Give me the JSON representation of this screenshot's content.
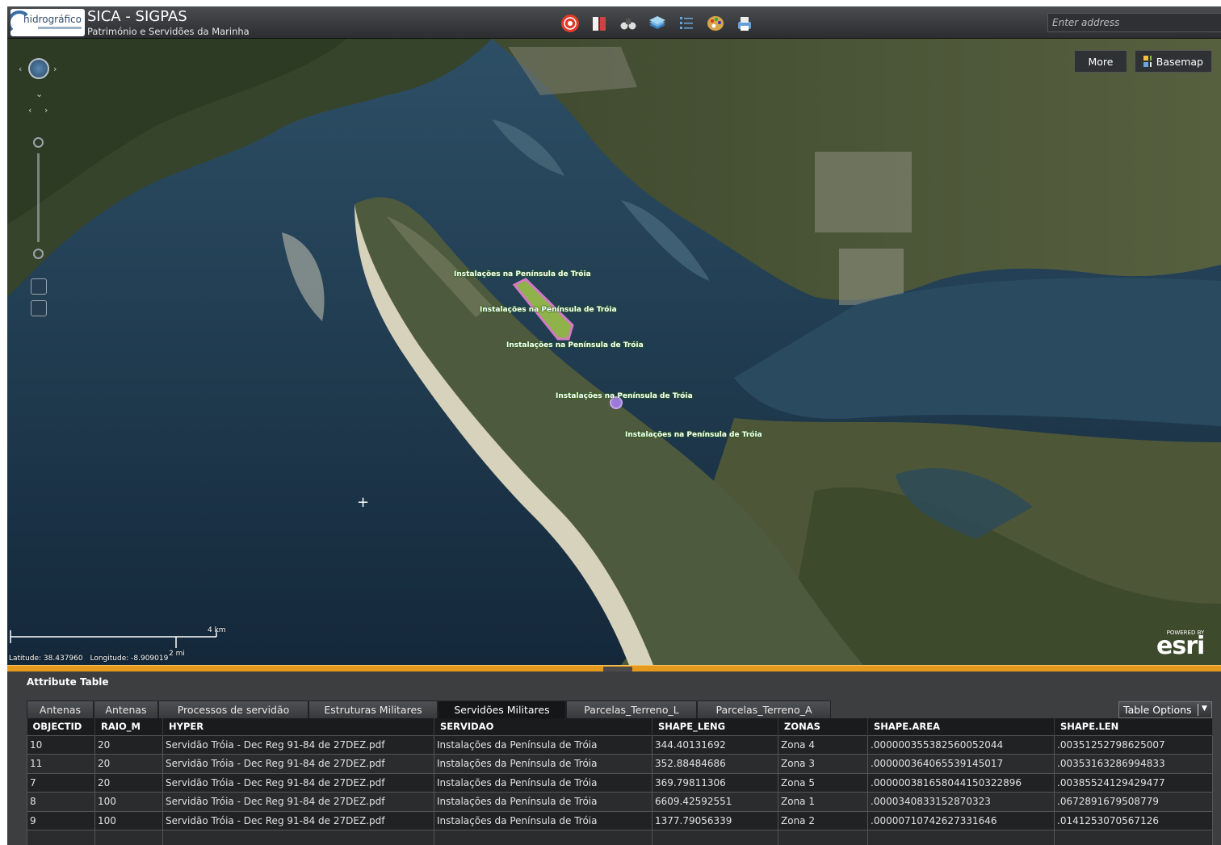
{
  "header": {
    "logo_text": "hidrográfico",
    "title": "SICA - SIGPAS",
    "subtitle": "Património e Servidões da Marinha",
    "search_placeholder": "Enter address",
    "tools": [
      {
        "name": "target-tool-icon",
        "color": "#e03a2a"
      },
      {
        "name": "book-tool-icon",
        "color": "#c94444"
      },
      {
        "name": "binoculars-tool-icon",
        "color": "#cccccc"
      },
      {
        "name": "layers-tool-icon",
        "color": "#5aa0d8"
      },
      {
        "name": "list-tool-icon",
        "color": "#5aa0d8"
      },
      {
        "name": "palette-tool-icon",
        "color": "#d8a64a"
      },
      {
        "name": "print-tool-icon",
        "color": "#6aa0d8"
      }
    ]
  },
  "map": {
    "more_label": "More",
    "basemap_label": "Basemap",
    "feature_labels": [
      "Instalações na Península de Tróia",
      "Instalações na Península de Tróia",
      "Instalações na Península de Tróia",
      "Instalações na Península de Tróia",
      "Instalações na Península de Tróia"
    ],
    "scale_km": "4 km",
    "scale_mi": "2 mi",
    "latitude": "Latitude: 38.437960",
    "longitude": "Longitude: -8.909019",
    "powered_by": "POWERED BY",
    "esri": "esri"
  },
  "attribute_table": {
    "title": "Attribute Table",
    "tabs": [
      {
        "label": "Antenas",
        "active": false
      },
      {
        "label": "Antenas",
        "active": false
      },
      {
        "label": "Processos de servidão",
        "active": false
      },
      {
        "label": "Estruturas Militares",
        "active": false
      },
      {
        "label": "Servidões Militares",
        "active": true
      },
      {
        "label": "Parcelas_Terreno_L",
        "active": false
      },
      {
        "label": "Parcelas_Terreno_A",
        "active": false
      }
    ],
    "table_options_label": "Table Options",
    "columns": [
      "OBJECTID",
      "RAIO_M",
      "HYPER",
      "SERVIDAO",
      "SHAPE_LENG",
      "ZONAS",
      "SHAPE.AREA",
      "SHAPE.LEN"
    ],
    "rows": [
      [
        "10",
        "20",
        "Servidão Tróia - Dec Reg 91-84 de 27DEZ.pdf",
        "Instalações da Península de Tróia",
        "344.40131692",
        "Zona 4",
        ".000000355382560052044",
        ".00351252798625007"
      ],
      [
        "11",
        "20",
        "Servidão Tróia - Dec Reg 91-84 de 27DEZ.pdf",
        "Instalações da Península de Tróia",
        "352.88484686",
        "Zona 3",
        ".000000364065539145017",
        ".00353163286994833"
      ],
      [
        "7",
        "20",
        "Servidão Tróia - Dec Reg 91-84 de 27DEZ.pdf",
        "Instalações da Península de Tróia",
        "369.79811306",
        "Zona 5",
        ".000000381658044150322896",
        ".00385524129429477"
      ],
      [
        "8",
        "100",
        "Servidão Tróia - Dec Reg 91-84 de 27DEZ.pdf",
        "Instalações da Península de Tróia",
        "6609.42592551",
        "Zona 1",
        ".0000340833152870323",
        ".0672891679508779"
      ],
      [
        "9",
        "100",
        "Servidão Tróia - Dec Reg 91-84 de 27DEZ.pdf",
        "Instalações da Península de Tróia",
        "1377.79056339",
        "Zona 2",
        ".00000710742627331646",
        ".0141253070567126"
      ],
      [
        "",
        "",
        "",
        "",
        "",
        "",
        "",
        ""
      ]
    ]
  }
}
